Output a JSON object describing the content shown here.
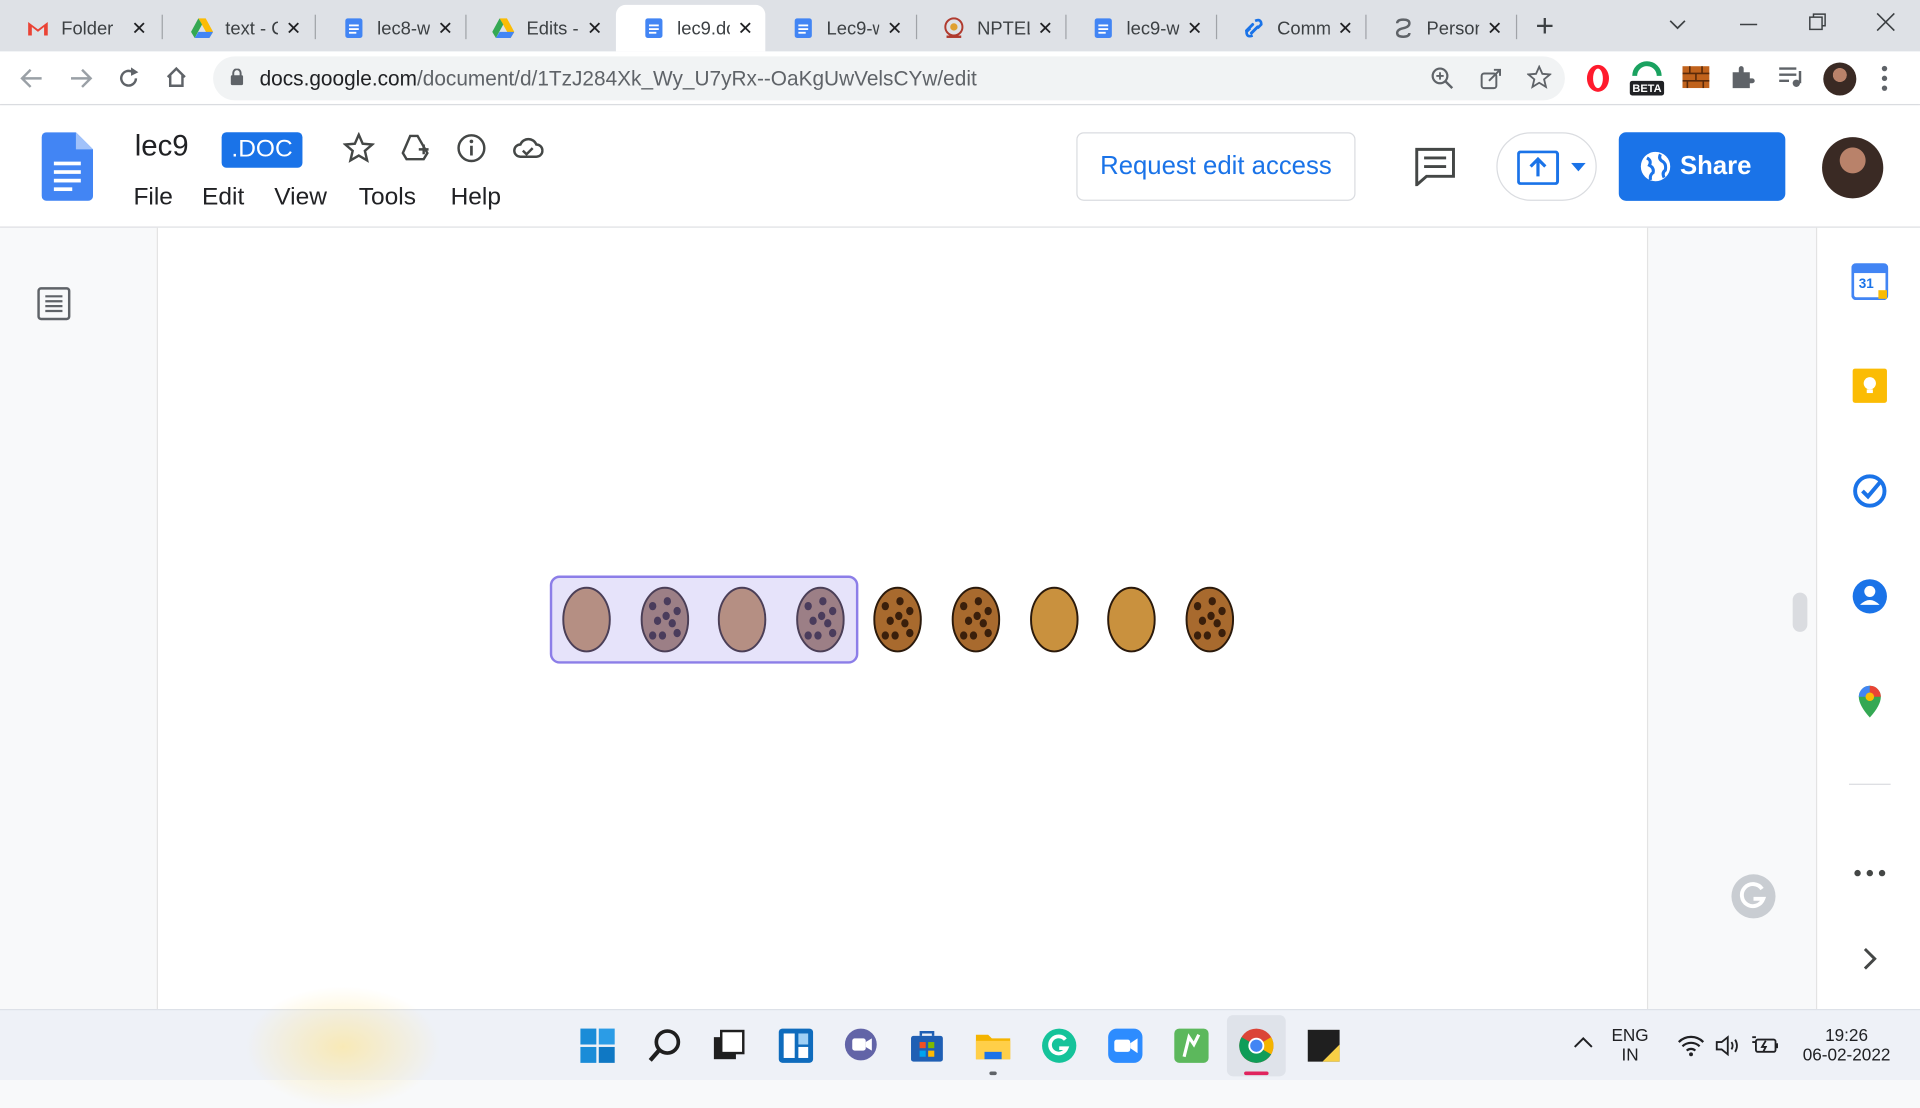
{
  "tabs": [
    {
      "label": "Folder",
      "icon": "gmail-icon"
    },
    {
      "label": "text - C",
      "icon": "drive-icon"
    },
    {
      "label": "lec8-w",
      "icon": "docs-icon"
    },
    {
      "label": "Edits -",
      "icon": "drive-icon"
    },
    {
      "label": "lec9.dc",
      "icon": "docs-icon",
      "active": true
    },
    {
      "label": "Lec9-w",
      "icon": "docs-icon"
    },
    {
      "label": "NPTEL",
      "icon": "nptel-icon"
    },
    {
      "label": "lec9-w",
      "icon": "docs-icon"
    },
    {
      "label": "Comm",
      "icon": "link-icon"
    },
    {
      "label": "Person",
      "icon": "person-link-icon"
    }
  ],
  "address": {
    "host": "docs.google.com",
    "path": "/document/d/1TzJ284Xk_Wy_U7yRx--OaKgUwVelsCYw/edit",
    "ext_badge": "BETA"
  },
  "doc": {
    "title": "lec9",
    "badge": ".DOC",
    "menu": [
      "File",
      "Edit",
      "View",
      "Tools",
      "Help"
    ],
    "request_edit": "Request edit access",
    "share": "Share"
  },
  "figure": {
    "items": [
      "plain",
      "chocolate-chip",
      "plain",
      "chocolate-chip",
      "chocolate-chip",
      "chocolate-chip",
      "plain",
      "plain",
      "chocolate-chip"
    ],
    "selected_count": 4
  },
  "side_panel": {
    "calendar_day": "31"
  },
  "taskbar": {
    "lang_top": "ENG",
    "lang_bottom": "IN",
    "time": "19:26",
    "date": "06-02-2022"
  },
  "colors": {
    "accent": "#1a73e8",
    "selection": "#8c7ee8",
    "cookie_plain_selected": "#b58f83",
    "cookie_plain": "#c9913e"
  }
}
